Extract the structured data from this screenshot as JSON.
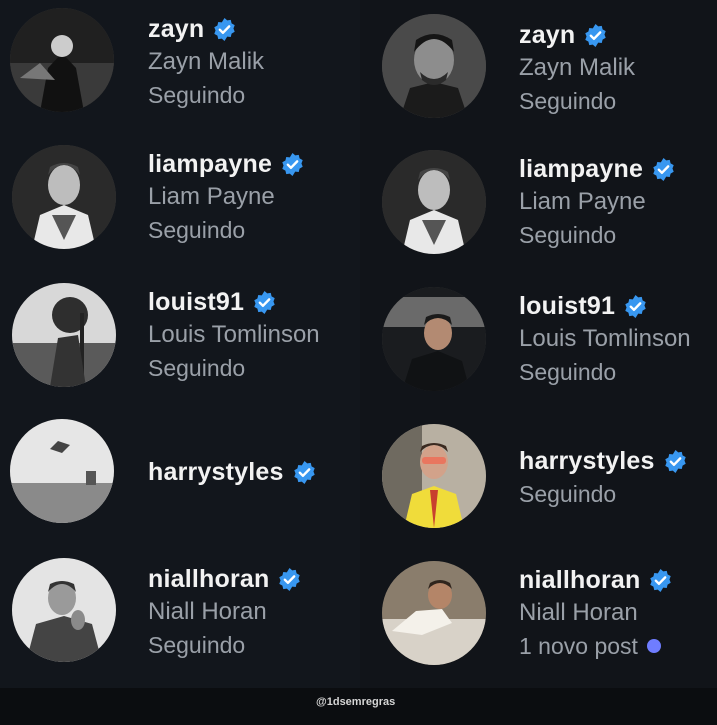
{
  "left": [
    {
      "handle": "zayn",
      "name": "Zayn Malik",
      "status": "Seguindo"
    },
    {
      "handle": "liampayne",
      "name": "Liam Payne",
      "status": "Seguindo"
    },
    {
      "handle": "louist91",
      "name": "Louis Tomlinson",
      "status": "Seguindo"
    },
    {
      "handle": "harrystyles",
      "name": "",
      "status": ""
    },
    {
      "handle": "niallhoran",
      "name": "Niall Horan",
      "status": "Seguindo"
    }
  ],
  "right": [
    {
      "handle": "zayn",
      "name": "Zayn Malik",
      "status": "Seguindo"
    },
    {
      "handle": "liampayne",
      "name": "Liam Payne",
      "status": "Seguindo"
    },
    {
      "handle": "louist91",
      "name": "Louis Tomlinson",
      "status": "Seguindo"
    },
    {
      "handle": "harrystyles",
      "name": "",
      "status": "Seguindo"
    },
    {
      "handle": "niallhoran",
      "name": "Niall Horan",
      "status": "1 novo post"
    }
  ],
  "watermark": "@1dsemregras",
  "colors": {
    "verified": "#3897f0",
    "new_post_dot": "#6f7dff",
    "background": "#12161c"
  }
}
